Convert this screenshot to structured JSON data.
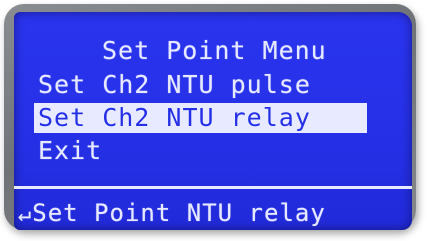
{
  "screen": {
    "title": "Set Point Menu",
    "menu_items": [
      {
        "label": "Set Ch2 NTU pulse",
        "selected": false
      },
      {
        "label": "Set Ch2 NTU relay",
        "selected": true
      },
      {
        "label": "Exit",
        "selected": false
      }
    ],
    "footer": {
      "icon": "enter-arrow-icon",
      "text": "Set Point NTU relay"
    }
  },
  "colors": {
    "lcd_background": "#2530e6",
    "lcd_text": "#e6e9ff",
    "bezel": "#7a7d82"
  }
}
